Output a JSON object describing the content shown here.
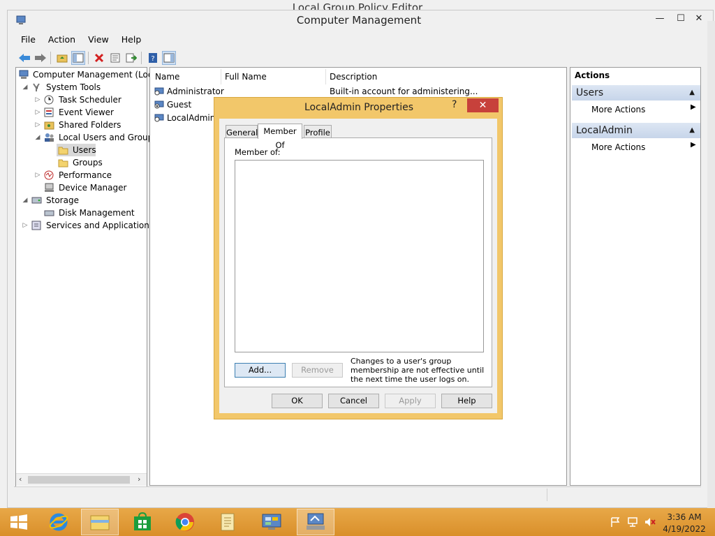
{
  "background_window": {
    "title": "Local Group Policy Editor"
  },
  "window": {
    "title": "Computer Management",
    "min": "—",
    "max": "☐",
    "close": "✕"
  },
  "menu": [
    "File",
    "Action",
    "View",
    "Help"
  ],
  "tree": {
    "root": "Computer Management (Local",
    "system_tools": "System Tools",
    "task_scheduler": "Task Scheduler",
    "event_viewer": "Event Viewer",
    "shared_folders": "Shared Folders",
    "local_users_groups": "Local Users and Groups",
    "users": "Users",
    "groups": "Groups",
    "performance": "Performance",
    "device_manager": "Device Manager",
    "storage": "Storage",
    "disk_management": "Disk Management",
    "services_apps": "Services and Applications"
  },
  "list": {
    "columns": [
      "Name",
      "Full Name",
      "Description"
    ],
    "rows": [
      {
        "name": "Administrator",
        "full_name": "",
        "description": "Built-in account for administering..."
      },
      {
        "name": "Guest",
        "full_name": "",
        "description": ""
      },
      {
        "name": "LocalAdmin",
        "full_name": "",
        "description": ""
      }
    ]
  },
  "actions": {
    "header": "Actions",
    "section1": "Users",
    "section1_item": "More Actions",
    "section2": "LocalAdmin",
    "section2_item": "More Actions"
  },
  "dialog": {
    "title": "LocalAdmin Properties",
    "help": "?",
    "close": "✕",
    "tabs": [
      "General",
      "Member Of",
      "Profile"
    ],
    "selected_tab": "Member Of",
    "member_of_label": "Member of:",
    "add": "Add...",
    "remove": "Remove",
    "note": "Changes to a user's group membership are not effective until the next time the user logs on.",
    "ok": "OK",
    "cancel": "Cancel",
    "apply": "Apply",
    "help_btn": "Help"
  },
  "taskbar": {
    "time": "3:36 AM",
    "date": "4/19/2022"
  },
  "colors": {
    "dialog_frame": "#f2c76a",
    "close_red": "#c7413b",
    "taskbar": "#e0992f",
    "actions_header": "#c7d5ea"
  }
}
